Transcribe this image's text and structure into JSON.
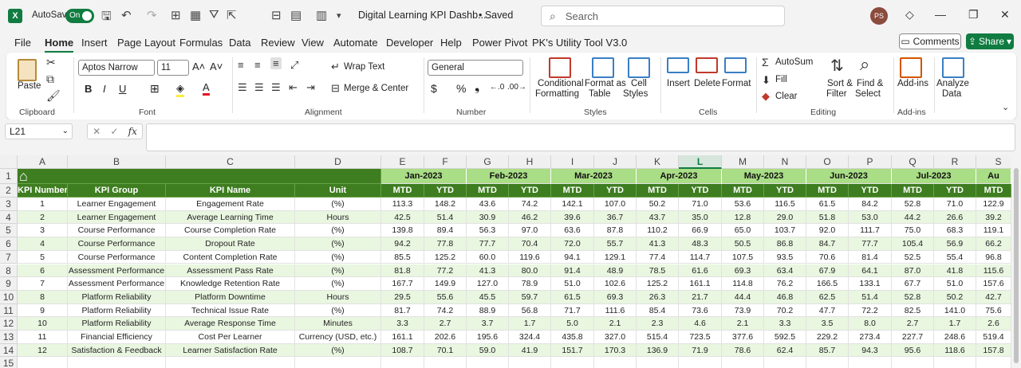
{
  "titlebar": {
    "autosave_label": "AutoSave",
    "autosave_state": "On",
    "doc_title": "Digital Learning KPI Dashb...",
    "save_status": "• Saved",
    "search_placeholder": "Search",
    "avatar_initials": "PS"
  },
  "menu": [
    "File",
    "Home",
    "Insert",
    "Page Layout",
    "Formulas",
    "Data",
    "Review",
    "View",
    "Automate",
    "Developer",
    "Help",
    "Power Pivot",
    "PK's Utility Tool V3.0"
  ],
  "menu_active": "Home",
  "actions": {
    "comments": "Comments",
    "share": "Share"
  },
  "ribbon": {
    "paste": "Paste",
    "clipboard": "Clipboard",
    "font_name": "Aptos Narrow",
    "font_size": "11",
    "font": "Font",
    "wrap_text": "Wrap Text",
    "merge_center": "Merge & Center",
    "alignment": "Alignment",
    "number_format": "General",
    "number": "Number",
    "cond_fmt_1": "Conditional",
    "cond_fmt_2": "Formatting",
    "fmt_table_1": "Format as",
    "fmt_table_2": "Table",
    "cell_styles_1": "Cell",
    "cell_styles_2": "Styles",
    "styles": "Styles",
    "insert": "Insert",
    "delete": "Delete",
    "format": "Format",
    "cells": "Cells",
    "autosum": "AutoSum",
    "fill": "Fill",
    "clear": "Clear",
    "sort_filter_1": "Sort &",
    "sort_filter_2": "Filter",
    "find_select_1": "Find &",
    "find_select_2": "Select",
    "editing": "Editing",
    "addins": "Add-ins",
    "addins_group": "Add-ins",
    "analyze_1": "Analyze",
    "analyze_2": "Data"
  },
  "formula_bar": {
    "name_box": "L21",
    "fx": "fx",
    "content": ""
  },
  "sheet": {
    "columns": [
      "A",
      "B",
      "C",
      "D",
      "E",
      "F",
      "G",
      "H",
      "I",
      "J",
      "K",
      "L",
      "M",
      "N",
      "O",
      "P",
      "Q",
      "R",
      "S"
    ],
    "selected_column": "L",
    "row_numbers": [
      "1",
      "2",
      "3",
      "4",
      "5",
      "6",
      "7",
      "8",
      "9",
      "10",
      "11",
      "12",
      "13",
      "14",
      "15"
    ],
    "headers": [
      "KPI Number",
      "KPI Group",
      "KPI Name",
      "Unit"
    ],
    "months": [
      "Jan-2023",
      "Feb-2023",
      "Mar-2023",
      "Apr-2023",
      "May-2023",
      "Jun-2023",
      "Jul-2023",
      "Au"
    ],
    "sub_headers": [
      "MTD",
      "YTD",
      "MTD",
      "YTD",
      "MTD",
      "YTD",
      "MTD",
      "YTD",
      "MTD",
      "YTD",
      "MTD",
      "YTD",
      "MTD",
      "YTD",
      "MTD"
    ],
    "rows": [
      {
        "num": "1",
        "group": "Learner Engagement",
        "name": "Engagement Rate",
        "unit": "(%)",
        "vals": [
          "113.3",
          "148.2",
          "43.6",
          "74.2",
          "142.1",
          "107.0",
          "50.2",
          "71.0",
          "53.6",
          "116.5",
          "61.5",
          "84.2",
          "52.8",
          "71.0",
          "122.9"
        ]
      },
      {
        "num": "2",
        "group": "Learner Engagement",
        "name": "Average Learning Time",
        "unit": "Hours",
        "vals": [
          "42.5",
          "51.4",
          "30.9",
          "46.2",
          "39.6",
          "36.7",
          "43.7",
          "35.0",
          "12.8",
          "29.0",
          "51.8",
          "53.0",
          "44.2",
          "26.6",
          "39.2"
        ]
      },
      {
        "num": "3",
        "group": "Course Performance",
        "name": "Course Completion Rate",
        "unit": "(%)",
        "vals": [
          "139.8",
          "89.4",
          "56.3",
          "97.0",
          "63.6",
          "87.8",
          "110.2",
          "66.9",
          "65.0",
          "103.7",
          "92.0",
          "111.7",
          "75.0",
          "68.3",
          "119.1"
        ]
      },
      {
        "num": "4",
        "group": "Course Performance",
        "name": "Dropout Rate",
        "unit": "(%)",
        "vals": [
          "94.2",
          "77.8",
          "77.7",
          "70.4",
          "72.0",
          "55.7",
          "41.3",
          "48.3",
          "50.5",
          "86.8",
          "84.7",
          "77.7",
          "105.4",
          "56.9",
          "66.2"
        ]
      },
      {
        "num": "5",
        "group": "Course Performance",
        "name": "Content Completion Rate",
        "unit": "(%)",
        "vals": [
          "85.5",
          "125.2",
          "60.0",
          "119.6",
          "94.1",
          "129.1",
          "77.4",
          "114.7",
          "107.5",
          "93.5",
          "70.6",
          "81.4",
          "52.5",
          "55.4",
          "96.8"
        ]
      },
      {
        "num": "6",
        "group": "Assessment Performance",
        "name": "Assessment Pass Rate",
        "unit": "(%)",
        "vals": [
          "81.8",
          "77.2",
          "41.3",
          "80.0",
          "91.4",
          "48.9",
          "78.5",
          "61.6",
          "69.3",
          "63.4",
          "67.9",
          "64.1",
          "87.0",
          "41.8",
          "115.6"
        ]
      },
      {
        "num": "7",
        "group": "Assessment Performance",
        "name": "Knowledge Retention Rate",
        "unit": "(%)",
        "vals": [
          "167.7",
          "149.9",
          "127.0",
          "78.9",
          "51.0",
          "102.6",
          "125.2",
          "161.1",
          "114.8",
          "76.2",
          "166.5",
          "133.1",
          "67.7",
          "51.0",
          "157.6"
        ]
      },
      {
        "num": "8",
        "group": "Platform Reliability",
        "name": "Platform Downtime",
        "unit": "Hours",
        "vals": [
          "29.5",
          "55.6",
          "45.5",
          "59.7",
          "61.5",
          "69.3",
          "26.3",
          "21.7",
          "44.4",
          "46.8",
          "62.5",
          "51.4",
          "52.8",
          "50.2",
          "42.7"
        ]
      },
      {
        "num": "9",
        "group": "Platform Reliability",
        "name": "Technical Issue Rate",
        "unit": "(%)",
        "vals": [
          "81.7",
          "74.2",
          "88.9",
          "56.8",
          "71.7",
          "111.6",
          "85.4",
          "73.6",
          "73.9",
          "70.2",
          "47.7",
          "72.2",
          "82.5",
          "141.0",
          "75.6"
        ]
      },
      {
        "num": "10",
        "group": "Platform Reliability",
        "name": "Average Response Time",
        "unit": "Minutes",
        "vals": [
          "3.3",
          "2.7",
          "3.7",
          "1.7",
          "5.0",
          "2.1",
          "2.3",
          "4.6",
          "2.1",
          "3.3",
          "3.5",
          "8.0",
          "2.7",
          "1.7",
          "2.6"
        ]
      },
      {
        "num": "11",
        "group": "Financial Efficiency",
        "name": "Cost Per Learner",
        "unit": "Currency (USD, etc.)",
        "vals": [
          "161.1",
          "202.6",
          "195.6",
          "324.4",
          "435.8",
          "327.0",
          "515.4",
          "723.5",
          "377.6",
          "592.5",
          "229.2",
          "273.4",
          "227.7",
          "248.6",
          "519.4"
        ]
      },
      {
        "num": "12",
        "group": "Satisfaction & Feedback",
        "name": "Learner Satisfaction Rate",
        "unit": "(%)",
        "vals": [
          "108.7",
          "70.1",
          "59.0",
          "41.9",
          "151.7",
          "170.3",
          "136.9",
          "71.9",
          "78.6",
          "62.4",
          "85.7",
          "94.3",
          "95.6",
          "118.6",
          "157.8"
        ]
      }
    ]
  }
}
